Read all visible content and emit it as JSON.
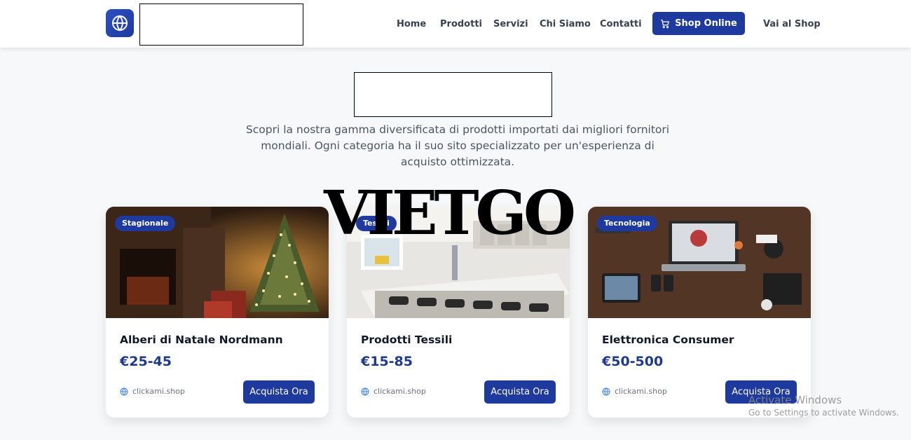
{
  "header": {
    "logo_icon": "globe-icon",
    "nav": [
      "Home",
      "Prodotti",
      "Servizi",
      "Chi Siamo",
      "Contatti"
    ],
    "shop_button": {
      "label": "Shop Online",
      "icon": "cart-icon"
    },
    "shop_link": "Vai al Shop"
  },
  "hero": {
    "description": "Scopri la nostra gamma diversificata di prodotti importati dai migliori fornitori mondiali. Ogni categoria ha il suo sito specializzato per un'esperienza di acquisto ottimizzata."
  },
  "products": [
    {
      "badge": "Stagionale",
      "title": "Alberi di Natale Nordmann",
      "price": "€25-45",
      "site": "clickami.shop",
      "button": "Acquista Ora"
    },
    {
      "badge": "Tessili",
      "title": "Prodotti Tessili",
      "price": "€15-85",
      "site": "clickami.shop",
      "button": "Acquista Ora"
    },
    {
      "badge": "Tecnologia",
      "title": "Elettronica Consumer",
      "price": "€50-500",
      "site": "clickami.shop",
      "button": "Acquista Ora"
    }
  ],
  "watermark": "VIETGO",
  "windows_activation": {
    "title": "Activate Windows",
    "subtitle": "Go to Settings to activate Windows."
  },
  "colors": {
    "primary": "#1e3a9e",
    "price": "#1e3a8a",
    "background": "#f7f8fa"
  }
}
